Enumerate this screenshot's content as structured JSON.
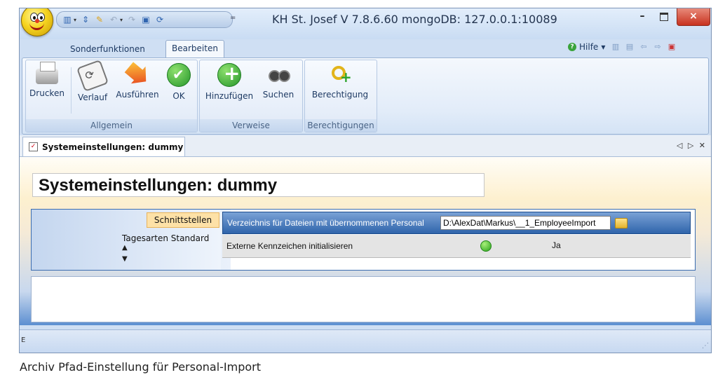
{
  "window": {
    "title": "KH St. Josef V 7.8.6.60 mongoDB: 127.0.0.1:10089",
    "min_glyph": "–",
    "close_glyph": "×"
  },
  "quick_access": {
    "icons": [
      "panel-icon",
      "sort-icon",
      "wand-icon",
      "undo-icon",
      "redo-icon",
      "save-icon",
      "refresh-icon"
    ],
    "more": "="
  },
  "tabs": {
    "sonderfunktionen": "Sonderfunktionen",
    "bearbeiten": "Bearbeiten",
    "help": "Hilfe",
    "help_dropdown": "▾"
  },
  "ribbon": {
    "groups": {
      "allgemein": "Allgemein",
      "verweise": "Verweise",
      "berechtigungen": "Berechtigungen"
    },
    "buttons": {
      "drucken": "Drucken",
      "verlauf": "Verlauf",
      "ausfuehren": "Ausführen",
      "ok": "OK",
      "hinzufuegen": "Hinzufügen",
      "suchen": "Suchen",
      "berechtigung": "Berechtigung"
    }
  },
  "document_tab": {
    "label": "Systemeinstellungen: dummy",
    "nav": "◁ ▷ ✕"
  },
  "content": {
    "title": "Systemeinstellungen: dummy",
    "menu": {
      "selected": "Schnittstellen",
      "item2": "Tagesarten Standard",
      "up": "▲",
      "down": "▼"
    },
    "rows": [
      {
        "caption": "Verzeichnis für Dateien mit übernommenen Personal",
        "value": "D:\\AlexDat\\Markus\\__1_EmployeeImport"
      },
      {
        "caption": "Externe Kennzeichen initialisieren",
        "status_color": "#2aa31a",
        "value": "Ja"
      }
    ]
  },
  "statusbar": {
    "text": "E",
    "grip": "⋰"
  },
  "caption": "Archiv Pfad-Einstellung für Personal-Import"
}
